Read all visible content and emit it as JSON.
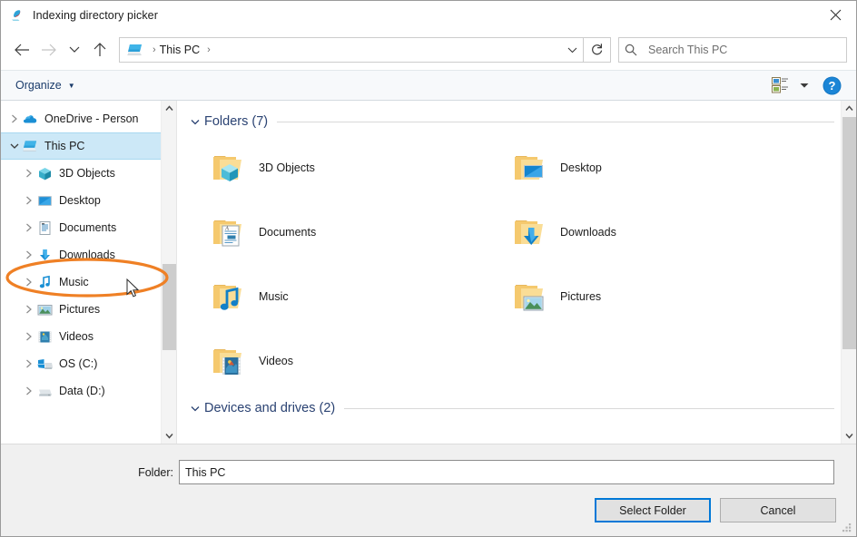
{
  "window": {
    "title": "Indexing directory picker",
    "title_icon": "app-kite-icon",
    "close_label": "Close"
  },
  "nav": {
    "back_icon": "arrow-left-icon",
    "forward_icon": "arrow-right-icon",
    "recent_icon": "chevron-down-icon",
    "up_icon": "arrow-up-icon",
    "breadcrumb": {
      "icon": "this-pc-icon",
      "crumbs": [
        "This PC"
      ],
      "separator": "›"
    },
    "address_dropdown_icon": "chevron-down-icon",
    "refresh_icon": "refresh-icon",
    "search": {
      "placeholder": "Search This PC",
      "icon": "search-icon"
    }
  },
  "commandbar": {
    "organize_label": "Organize",
    "organize_caret": "▼",
    "view_mode_icon": "view-details-icon",
    "view_dropdown_icon": "caret-down-icon",
    "help_icon": "help-icon",
    "help_label": "?"
  },
  "sidebar": {
    "items": [
      {
        "label": "OneDrive - Person",
        "icon": "onedrive-icon",
        "expander": "chevron-right",
        "indent": 0,
        "selected": false
      },
      {
        "label": "This PC",
        "icon": "this-pc-icon",
        "expander": "chevron-down",
        "indent": 0,
        "selected": true
      },
      {
        "label": "3D Objects",
        "icon": "3d-objects-icon",
        "expander": "chevron-right",
        "indent": 1,
        "selected": false
      },
      {
        "label": "Desktop",
        "icon": "desktop-icon",
        "expander": "chevron-right",
        "indent": 1,
        "selected": false
      },
      {
        "label": "Documents",
        "icon": "documents-icon",
        "expander": "chevron-right",
        "indent": 1,
        "selected": false
      },
      {
        "label": "Downloads",
        "icon": "downloads-icon",
        "expander": "chevron-right",
        "indent": 1,
        "selected": false
      },
      {
        "label": "Music",
        "icon": "music-icon",
        "expander": "chevron-right",
        "indent": 1,
        "selected": false
      },
      {
        "label": "Pictures",
        "icon": "pictures-icon",
        "expander": "chevron-right",
        "indent": 1,
        "selected": false
      },
      {
        "label": "Videos",
        "icon": "videos-icon",
        "expander": "chevron-right",
        "indent": 1,
        "selected": false
      },
      {
        "label": "OS (C:)",
        "icon": "windows-drive-icon",
        "expander": "chevron-right",
        "indent": 1,
        "selected": false
      },
      {
        "label": "Data (D:)",
        "icon": "drive-icon",
        "expander": "chevron-right",
        "indent": 1,
        "selected": false
      }
    ],
    "scrollbar": {
      "up_icon": "chevron-up-icon",
      "down_icon": "chevron-down-icon"
    }
  },
  "content": {
    "groups": [
      {
        "header": "Folders (7)",
        "chevron": "chevron-down-icon",
        "items": [
          {
            "label": "3D Objects",
            "icon": "folder-3d-objects-icon"
          },
          {
            "label": "Desktop",
            "icon": "folder-desktop-icon"
          },
          {
            "label": "Documents",
            "icon": "folder-documents-icon"
          },
          {
            "label": "Downloads",
            "icon": "folder-downloads-icon"
          },
          {
            "label": "Music",
            "icon": "folder-music-icon"
          },
          {
            "label": "Pictures",
            "icon": "folder-pictures-icon"
          },
          {
            "label": "Videos",
            "icon": "folder-videos-icon"
          }
        ]
      },
      {
        "header": "Devices and drives (2)",
        "chevron": "chevron-down-icon",
        "items": []
      }
    ],
    "scrollbar": {
      "up_icon": "chevron-up-icon",
      "down_icon": "chevron-down-icon"
    }
  },
  "footer": {
    "folder_label": "Folder:",
    "folder_value": "This PC",
    "select_button": "Select Folder",
    "cancel_button": "Cancel"
  },
  "annotation": {
    "shape": "ellipse-highlight",
    "color": "#ef8025",
    "target": "This PC"
  },
  "colors": {
    "selection": "#cce8f7",
    "group_header": "#2a4272",
    "accent": "#0078d7",
    "annotation": "#ef8025",
    "folder": "#f6d28a"
  }
}
